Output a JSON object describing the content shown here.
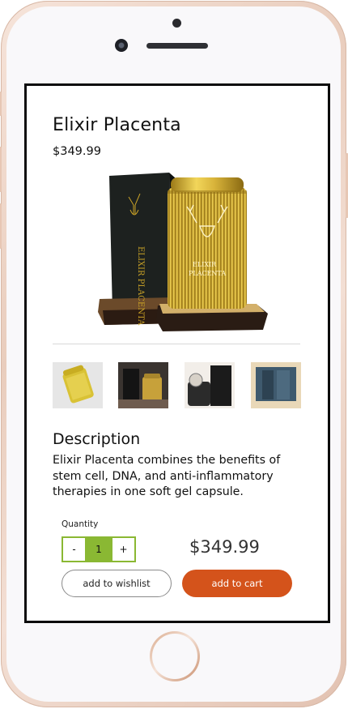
{
  "product": {
    "title": "Elixir Placenta",
    "price": "$349.99",
    "image_alt_text": "ELIXIR PLACENTA"
  },
  "description": {
    "heading": "Description",
    "text": "Elixir Placenta combines the benefits of stem cell, DNA, and anti-inflammatory therapies in one soft gel capsule."
  },
  "quantity": {
    "label": "Quantity",
    "minus": "-",
    "value": "1",
    "plus": "+"
  },
  "total_price": "$349.99",
  "actions": {
    "wishlist": "add to wishlist",
    "cart": "add to cart"
  },
  "colors": {
    "accent_green": "#8ab833",
    "cart_orange": "#d4531b",
    "gold": "#c9a227"
  }
}
